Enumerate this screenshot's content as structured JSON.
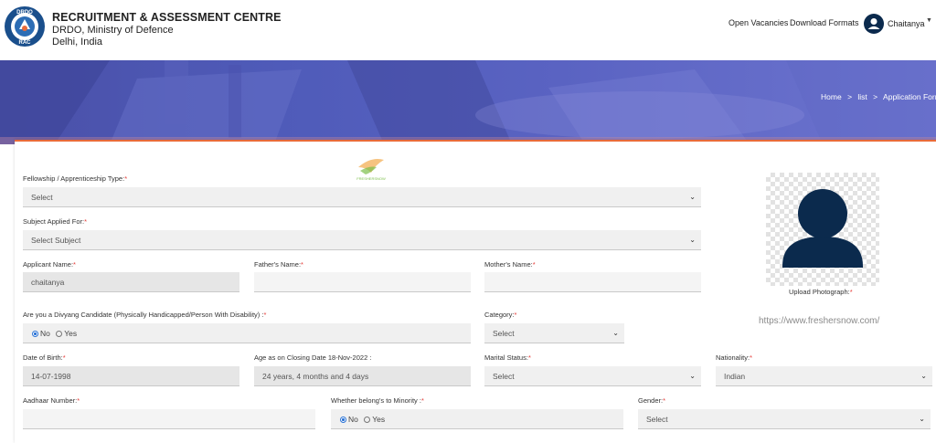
{
  "header": {
    "org_title": "RECRUITMENT & ASSESSMENT CENTRE",
    "org_line2": "DRDO, Ministry of Defence",
    "org_line3": "Delhi, India",
    "nav": [
      "Open Vacancies",
      "Download Formats"
    ],
    "user_name": "Chaitanya",
    "logo_text_top": "DRDO",
    "logo_text_bottom": "RAC"
  },
  "breadcrumb": [
    "Home",
    ">",
    "list",
    ">",
    "Application Form"
  ],
  "form": {
    "fellowship_label": "Fellowship / Apprenticeship Type:",
    "fellowship_value": "Select",
    "subject_label": "Subject Applied For:",
    "subject_value": "Select Subject",
    "applicant_label": "Applicant Name:",
    "applicant_value": "chaitanya",
    "father_label": "Father's Name:",
    "father_value": "",
    "mother_label": "Mother's Name:",
    "mother_value": "",
    "divyang_label": "Are you a Divyang Candidate (Physically Handicapped/Person With Disability) :",
    "divyang_no": "No",
    "divyang_yes": "Yes",
    "category_label": "Category:",
    "category_value": "Select",
    "dob_label": "Date of Birth:",
    "dob_value": "14-07-1998",
    "age_label": "Age as on Closing Date 18-Nov-2022 :",
    "age_value": "24 years, 4 months and 4 days",
    "marital_label": "Marital Status:",
    "marital_value": "Select",
    "nationality_label": "Nationality:",
    "nationality_value": "Indian",
    "aadhaar_label": "Aadhaar Number:",
    "minority_label": "Whether belong's to Minority :",
    "minority_no": "No",
    "minority_yes": "Yes",
    "gender_label": "Gender:",
    "gender_value": "Select",
    "required_mark": "*"
  },
  "photo": {
    "label": "Upload Photograph:"
  },
  "watermark": {
    "url": "https://www.freshersnow.com/",
    "logo_text": "FRESHERSNOW"
  },
  "colors": {
    "accent": "#e86b3a",
    "banner": "#4f5bb9",
    "avatar": "#0b2a4d"
  }
}
